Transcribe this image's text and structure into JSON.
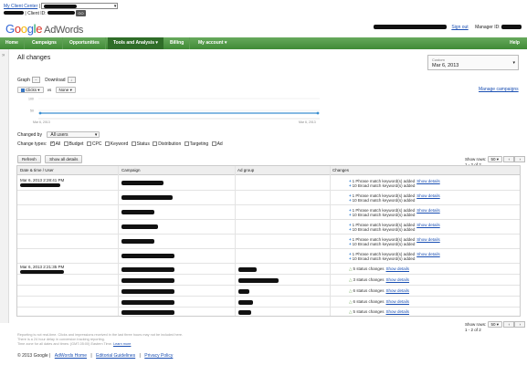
{
  "mcc": {
    "label": "My Client Center",
    "client_id_label": "| Client ID:",
    "go_label": "GO"
  },
  "header": {
    "logo_google": "Google",
    "logo_adwords": "AdWords",
    "signout": "Sign out",
    "manager_id_label": "Manager ID:"
  },
  "nav": {
    "items": [
      "Home",
      "Campaigns",
      "Opportunities",
      "Tools and Analysis ▾",
      "Billing",
      "My account ▾"
    ],
    "help": "Help"
  },
  "page": {
    "title": "All changes",
    "date_label": "Custom",
    "date_value": "Mar 6, 2013",
    "graph_label": "Graph",
    "download_label": "Download",
    "metric1": "Clicks",
    "vs_label": "vs",
    "metric2": "None",
    "manage_campaigns": "Manage campaigns",
    "chart_x_start": "Mar 6, 2013",
    "chart_x_end": "Mar 6, 2013",
    "chart_y_top": "100",
    "chart_y_mid": "50",
    "changed_by_label": "Changed by",
    "changed_by_value": "All users",
    "change_types_label": "Change types:",
    "change_types": [
      "All",
      "Budget",
      "CPC",
      "Keyword",
      "Status",
      "Distribution",
      "Targeting",
      "Ad"
    ],
    "refresh": "Refresh",
    "show_all_details": "Show all details",
    "show_rows_label": "Show rows:",
    "rows_value": "50 ▾",
    "page_info": "1 - 2 of 2"
  },
  "table": {
    "headers": [
      "Date & time / User",
      "Campaign",
      "Ad group",
      "Changes"
    ],
    "row1_date": "Mar 6, 2013 2:28:41 PM",
    "row2_date": "Mar 6, 2013 2:21:35 PM",
    "changes_kw": [
      [
        "1 Phrase match keyword(s) added",
        "10 Broad match keyword(s) added"
      ],
      [
        "1 Phrase match keyword(s) added",
        "10 Broad match keyword(s) added"
      ],
      [
        "1 Phrase match keyword(s) added",
        "10 Broad match keyword(s) added"
      ],
      [
        "1 Phrase match keyword(s) added",
        "10 Broad match keyword(s) added"
      ],
      [
        "1 Phrase match keyword(s) added",
        "10 Broad match keyword(s) added"
      ],
      [
        "1 Phrase match keyword(s) added",
        "10 Broad match keyword(s) added"
      ]
    ],
    "status_changes": [
      "5 status changes",
      "3 status changes",
      "6 status changes",
      "6 status changes",
      "5 status changes"
    ],
    "show_details": "Show details"
  },
  "footnote": {
    "line1": "Reporting is not real-time. Clicks and impressions received in the last three hours may not be included here.",
    "line2": "There is a 24 hour delay in conversion tracking reporting.",
    "line3": "Time zone for all dates and times: (GMT-05:00) Eastern Time.",
    "learn_more": "Learn more"
  },
  "footer": {
    "copyright": "© 2013 Google",
    "links": [
      "AdWords Home",
      "Editorial Guidelines",
      "Privacy Policy"
    ]
  },
  "colors": {
    "nav_green": "#3f8a36",
    "link_blue": "#1a4fb3",
    "chart_line": "#3a8fd0"
  }
}
